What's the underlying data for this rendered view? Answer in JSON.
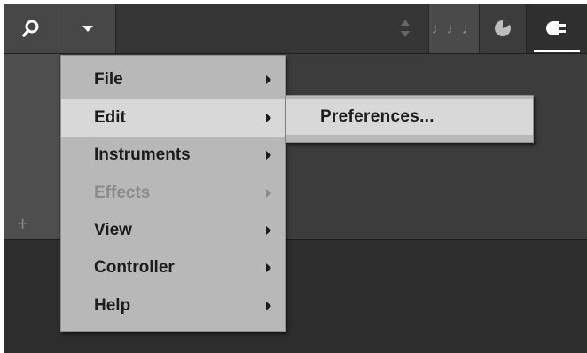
{
  "toolbar": {
    "buttons": [
      {
        "name": "search",
        "icon": "search-icon"
      },
      {
        "name": "menu",
        "icon": "triangle-down-icon"
      },
      {
        "name": "scroll",
        "icon": "up-down-icon"
      },
      {
        "name": "notes",
        "icon": "notes-icon",
        "glyph": "♩♩♩"
      },
      {
        "name": "knob",
        "icon": "knob-icon"
      },
      {
        "name": "plugin",
        "icon": "plug-icon"
      }
    ]
  },
  "left_panel": {
    "add_glyph": "+"
  },
  "menu": {
    "items": [
      {
        "label": "File",
        "has_submenu": true,
        "state": "normal"
      },
      {
        "label": "Edit",
        "has_submenu": true,
        "state": "active"
      },
      {
        "label": "Instruments",
        "has_submenu": true,
        "state": "normal"
      },
      {
        "label": "Effects",
        "has_submenu": true,
        "state": "disabled"
      },
      {
        "label": "View",
        "has_submenu": true,
        "state": "normal"
      },
      {
        "label": "Controller",
        "has_submenu": true,
        "state": "normal"
      },
      {
        "label": "Help",
        "has_submenu": true,
        "state": "normal"
      }
    ]
  },
  "submenu": {
    "items": [
      {
        "label": "Preferences..."
      }
    ]
  },
  "colors": {
    "menu_bg": "#b8b8b8",
    "menu_highlight": "#d8d8d8",
    "menu_text": "#1c1c1c",
    "menu_disabled_text": "#8c8c8c",
    "toolbar_bg": "#3a3a3a"
  }
}
